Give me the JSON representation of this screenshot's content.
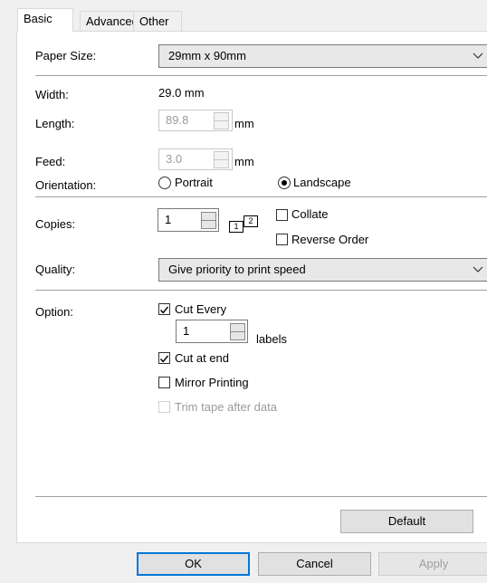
{
  "tabs": [
    "Basic",
    "Advanced",
    "Other"
  ],
  "paper_size": {
    "label": "Paper Size:",
    "value": "29mm x 90mm"
  },
  "width": {
    "label": "Width:",
    "value": "29.0 mm"
  },
  "length": {
    "label": "Length:",
    "value": "89.8",
    "unit": "mm"
  },
  "feed": {
    "label": "Feed:",
    "value": "3.0",
    "unit": "mm"
  },
  "orientation": {
    "label": "Orientation:",
    "portrait": "Portrait",
    "landscape": "Landscape",
    "selected": "Landscape"
  },
  "copies": {
    "label": "Copies:",
    "value": "1",
    "icon_text_1": "1",
    "icon_text_2": "2",
    "collate": "Collate",
    "reverse_order": "Reverse Order"
  },
  "quality": {
    "label": "Quality:",
    "value": "Give priority to print speed"
  },
  "option": {
    "label": "Option:",
    "cut_every": "Cut Every",
    "cut_every_value": "1",
    "labels_unit": "labels",
    "cut_at_end": "Cut at end",
    "mirror_printing": "Mirror Printing",
    "trim_tape": "Trim tape after data"
  },
  "buttons": {
    "default": "Default",
    "ok": "OK",
    "cancel": "Cancel",
    "apply": "Apply"
  }
}
